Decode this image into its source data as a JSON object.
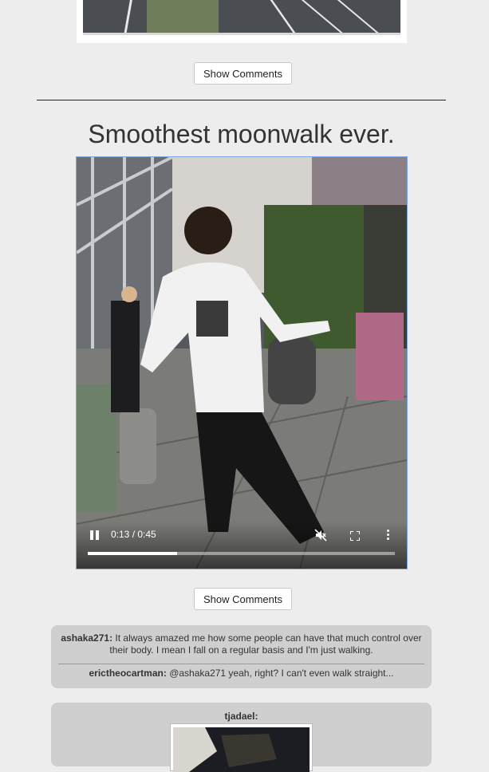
{
  "previous_post": {
    "show_comments_label": "Show Comments"
  },
  "post": {
    "title": "Smoothest moonwalk ever.",
    "video": {
      "time": "0:13 / 0:45",
      "progress_fraction": 0.29,
      "muted": true
    },
    "show_comments_label": "Show Comments",
    "comments": [
      {
        "user": "ashaka271:",
        "text": "It always amazed me how some people can have that much control over their body. I mean I fall on a regular basis and I'm just walking."
      },
      {
        "user": "erictheocartman:",
        "text": "@ashaka271 yeah, right? I can't even walk straight..."
      }
    ]
  },
  "next_post": {
    "user": "tjadael:"
  },
  "colors": {
    "page_bg": "#ededed",
    "comment_bg": "#cfcfcf",
    "video_border": "#7ea9de"
  }
}
